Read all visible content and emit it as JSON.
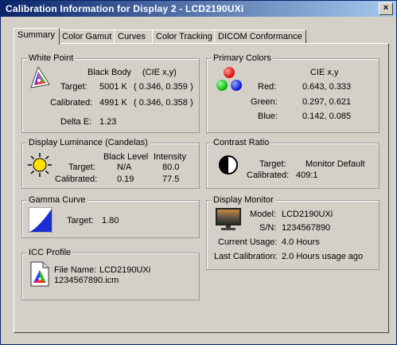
{
  "window": {
    "title": "Calibration Information for Display 2 - LCD2190UXi",
    "close": "×"
  },
  "tabs": [
    "Summary",
    "Color Gamut",
    "Curves",
    "Color Tracking",
    "DICOM Conformance"
  ],
  "white_point": {
    "title": "White Point",
    "col_black_body": "Black Body",
    "col_cie": "(CIE x,y)",
    "target_label": "Target:",
    "target_k": "5001 K",
    "target_xy": "( 0.346, 0.359 )",
    "calibrated_label": "Calibrated:",
    "calibrated_k": "4991 K",
    "calibrated_xy": "( 0.346, 0.358 )",
    "delta_label": "Delta E:",
    "delta_value": "1.23"
  },
  "primary_colors": {
    "title": "Primary Colors",
    "col_cie": "CIE x,y",
    "red_label": "Red:",
    "red_value": "0.643, 0.333",
    "green_label": "Green:",
    "green_value": "0.297, 0.621",
    "blue_label": "Blue:",
    "blue_value": "0.142, 0.085"
  },
  "luminance": {
    "title": "Display Luminance (Candelas)",
    "col_black": "Black Level",
    "col_intensity": "Intensity",
    "target_label": "Target:",
    "target_black": "N/A",
    "target_intensity": "80.0",
    "calibrated_label": "Calibrated:",
    "calibrated_black": "0.19",
    "calibrated_intensity": "77.5"
  },
  "contrast": {
    "title": "Contrast Ratio",
    "target_label": "Target:",
    "target_value": "Monitor Default",
    "calibrated_label": "Calibrated:",
    "calibrated_value": "409:1"
  },
  "gamma": {
    "title": "Gamma Curve",
    "target_label": "Target:",
    "target_value": "1.80"
  },
  "monitor": {
    "title": "Display Monitor",
    "model_label": "Model:",
    "model_value": "LCD2190UXi",
    "sn_label": "S/N:",
    "sn_value": "1234567890",
    "usage_label": "Current Usage:",
    "usage_value": "4.0 Hours",
    "lastcal_label": "Last Calibration:",
    "lastcal_value": "2.0 Hours usage ago"
  },
  "icc": {
    "title": "ICC Profile",
    "file_label": "File Name:",
    "file_value": "LCD2190UXi",
    "file_line2": "1234567890.icm"
  }
}
